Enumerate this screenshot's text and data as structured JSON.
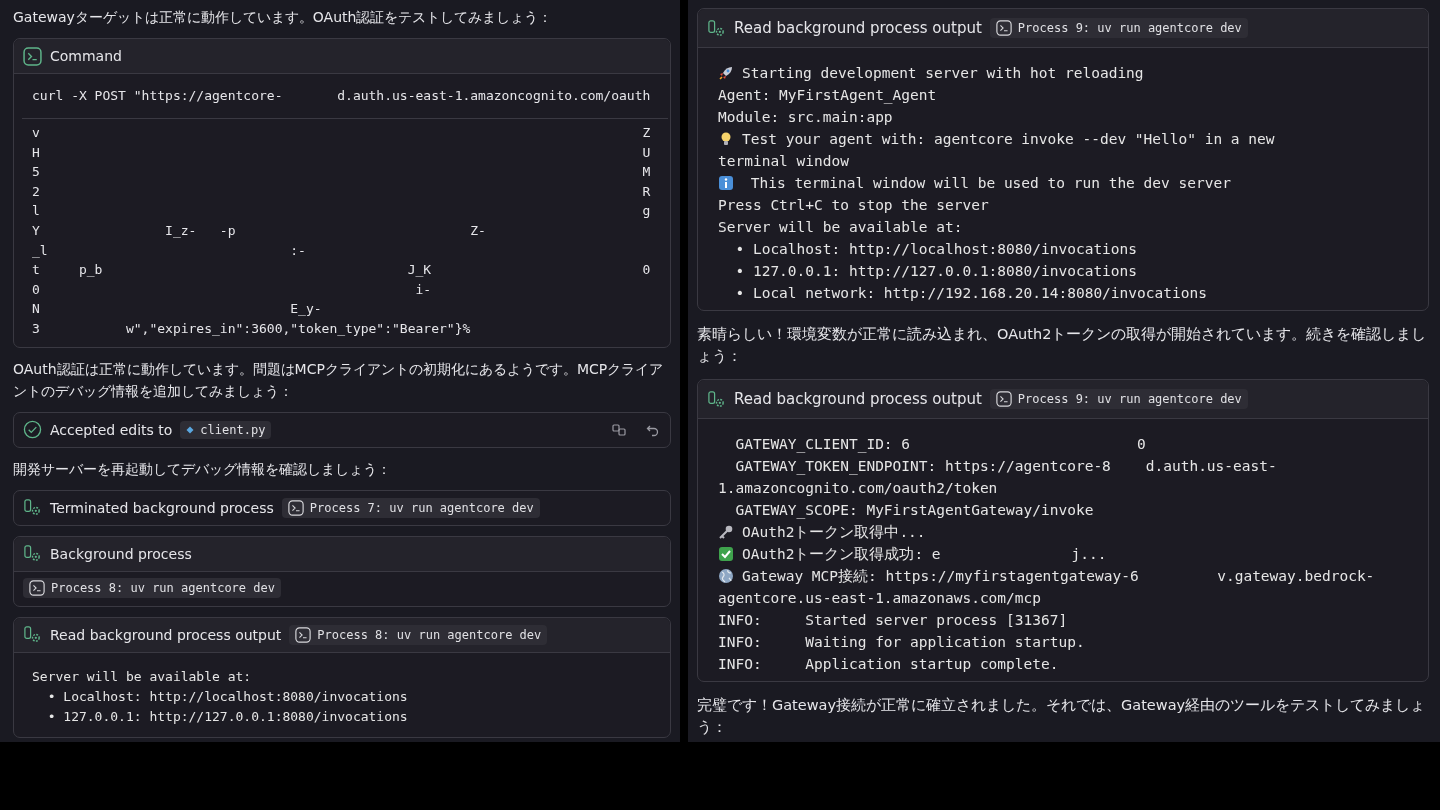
{
  "left": {
    "blocks": [
      {
        "kind": "text",
        "text": "Gatewayターゲットは正常に動作しています。OAuth認証をテストしてみましょう："
      },
      {
        "kind": "command",
        "title": "Command",
        "command": "curl -X POST \"https://agentcore-       d.auth.us-east-1.amazoncognito.com/oauth",
        "output": [
          "v                                                                             Z",
          "H                                                                             U",
          "5                                                                             M",
          "2                                                                             R",
          "l                                                                             g",
          "Y                I_z-   -p                              Z-",
          "_l                               :-",
          "t     p_b                                       J_K                           0",
          "0                                                i-",
          "N                                E_y-",
          "3           w\",\"expires_in\":3600,\"token_type\":\"Bearer\"}%"
        ]
      },
      {
        "kind": "text",
        "text": "OAuth認証は正常に動作しています。問題はMCPクライアントの初期化にあるようです。MCPクライアントのデバッグ情報を追加してみましょう："
      },
      {
        "kind": "edit",
        "label": "Accepted edits to",
        "file": "client.py"
      },
      {
        "kind": "text",
        "text": "開発サーバーを再起動してデバッグ情報を確認しましょう："
      },
      {
        "kind": "process",
        "title": "Terminated background process",
        "process": "Process 7: uv run agentcore dev"
      },
      {
        "kind": "process_panel",
        "title": "Background process",
        "process": "Process 8: uv run agentcore dev"
      },
      {
        "kind": "output",
        "title": "Read background process output",
        "process": "Process 8: uv run agentcore dev",
        "lines": [
          {
            "kind": "plain",
            "text": "Server will be available at:"
          },
          {
            "kind": "plain",
            "text": "  • Localhost: http://localhost:8080/invocations"
          },
          {
            "kind": "plain",
            "text": "  • 127.0.0.1: http://127.0.0.1:8080/invocations"
          }
        ]
      }
    ]
  },
  "right": {
    "blocks": [
      {
        "kind": "output",
        "title": "Read background process output",
        "process": "Process 9: uv run agentcore dev",
        "lines": [
          {
            "kind": "launch",
            "text": "Starting development server with hot reloading"
          },
          {
            "kind": "plain",
            "text": "Agent: MyFirstAgent_Agent"
          },
          {
            "kind": "plain",
            "text": "Module: src.main:app"
          },
          {
            "kind": "tip",
            "text": "Test your agent with: agentcore invoke --dev \"Hello\" in a new"
          },
          {
            "kind": "plain",
            "text": "terminal window"
          },
          {
            "kind": "info",
            "text": " This terminal window will be used to run the dev server"
          },
          {
            "kind": "plain",
            "text": "Press Ctrl+C to stop the server"
          },
          {
            "kind": "plain",
            "text": "Server will be available at:"
          },
          {
            "kind": "plain",
            "text": "  • Localhost: http://localhost:8080/invocations"
          },
          {
            "kind": "plain",
            "text": "  • 127.0.0.1: http://127.0.0.1:8080/invocations"
          },
          {
            "kind": "plain",
            "text": "  • Local network: http://192.168.20.14:8080/invocations"
          }
        ]
      },
      {
        "kind": "text",
        "text": "素晴らしい！環境変数が正常に読み込まれ、OAuth2トークンの取得が開始されています。続きを確認しましょう："
      },
      {
        "kind": "output",
        "title": "Read background process output",
        "process": "Process 9: uv run agentcore dev",
        "lines": [
          {
            "kind": "plain",
            "text": "  GATEWAY_CLIENT_ID: 6                          0"
          },
          {
            "kind": "plain",
            "text": "  GATEWAY_TOKEN_ENDPOINT: https://agentcore-8    d.auth.us-east-"
          },
          {
            "kind": "plain",
            "text": "1.amazoncognito.com/oauth2/token"
          },
          {
            "kind": "plain",
            "text": "  GATEWAY_SCOPE: MyFirstAgentGateway/invoke"
          },
          {
            "kind": "pending",
            "text": "OAuth2トークン取得中..."
          },
          {
            "kind": "success",
            "text": "OAuth2トークン取得成功: e               j..."
          },
          {
            "kind": "network",
            "text": "Gateway MCP接続: https://myfirstagentgateway-6         v.gateway.bedrock-"
          },
          {
            "kind": "plain",
            "text": "agentcore.us-east-1.amazonaws.com/mcp"
          },
          {
            "kind": "plain",
            "text": "INFO:     Started server process [31367]"
          },
          {
            "kind": "plain",
            "text": "INFO:     Waiting for application startup."
          },
          {
            "kind": "plain",
            "text": "INFO:     Application startup complete."
          }
        ]
      },
      {
        "kind": "text",
        "text": "完璧です！Gateway接続が正常に確立されました。それでは、Gateway経由のツールをテストしてみましょう："
      }
    ]
  }
}
